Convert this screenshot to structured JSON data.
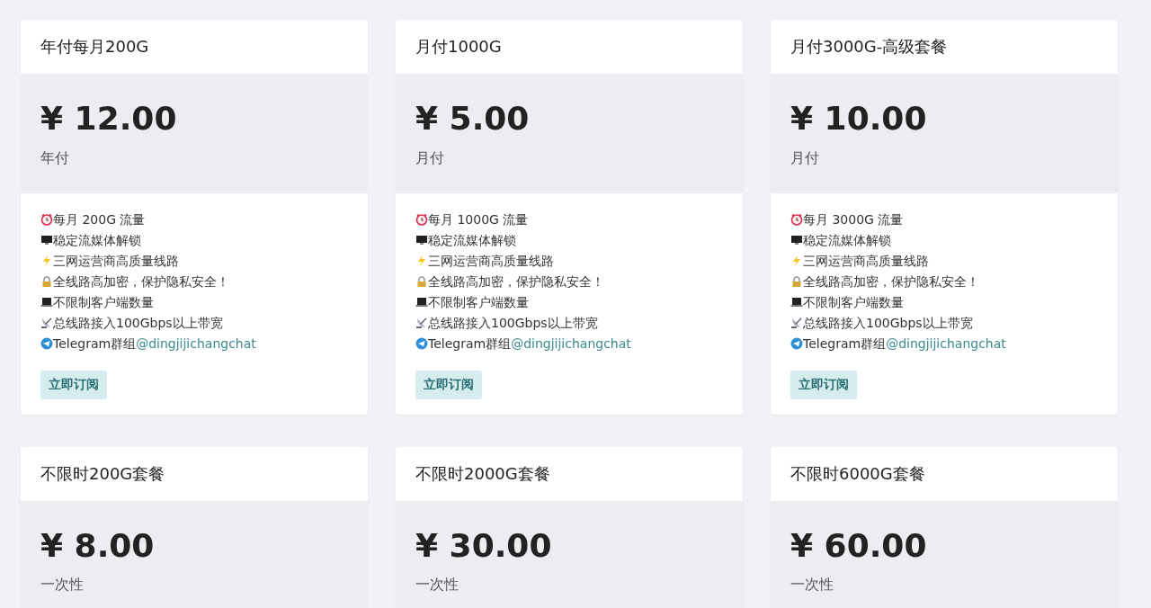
{
  "plans": [
    {
      "title": "年付每月200G",
      "price": "¥ 12.00",
      "period": "年付",
      "features": [
        {
          "kind": "clock",
          "text": "每月 200G 流量"
        },
        {
          "kind": "monitor",
          "text": "稳定流媒体解锁"
        },
        {
          "kind": "bolt",
          "text": "三网运营商高质量线路"
        },
        {
          "kind": "lock",
          "text": "全线路高加密，保护隐私安全！"
        },
        {
          "kind": "laptop",
          "text": "不限制客户端数量"
        },
        {
          "kind": "satellite",
          "text": "总线路接入100Gbps以上带宽"
        },
        {
          "kind": "telegram",
          "text": "Telegram群组",
          "link": "@dingjijichangchat"
        }
      ],
      "button": "立即订阅"
    },
    {
      "title": "月付1000G",
      "price": "¥ 5.00",
      "period": "月付",
      "features": [
        {
          "kind": "clock",
          "text": "每月 1000G 流量"
        },
        {
          "kind": "monitor",
          "text": "稳定流媒体解锁"
        },
        {
          "kind": "bolt",
          "text": "三网运营商高质量线路"
        },
        {
          "kind": "lock",
          "text": "全线路高加密，保护隐私安全！"
        },
        {
          "kind": "laptop",
          "text": "不限制客户端数量"
        },
        {
          "kind": "satellite",
          "text": "总线路接入100Gbps以上带宽"
        },
        {
          "kind": "telegram",
          "text": "Telegram群组",
          "link": "@dingjijichangchat"
        }
      ],
      "button": "立即订阅"
    },
    {
      "title": "月付3000G-高级套餐",
      "price": "¥ 10.00",
      "period": "月付",
      "features": [
        {
          "kind": "clock",
          "text": "每月 3000G 流量"
        },
        {
          "kind": "monitor",
          "text": "稳定流媒体解锁"
        },
        {
          "kind": "bolt",
          "text": "三网运营商高质量线路"
        },
        {
          "kind": "lock",
          "text": "全线路高加密，保护隐私安全！"
        },
        {
          "kind": "laptop",
          "text": "不限制客户端数量"
        },
        {
          "kind": "satellite",
          "text": "总线路接入100Gbps以上带宽"
        },
        {
          "kind": "telegram",
          "text": "Telegram群组",
          "link": "@dingjijichangchat"
        }
      ],
      "button": "立即订阅"
    },
    {
      "title": "不限时200G套餐",
      "price": "¥ 8.00",
      "period": "一次性"
    },
    {
      "title": "不限时2000G套餐",
      "price": "¥ 30.00",
      "period": "一次性"
    },
    {
      "title": "不限时6000G套餐",
      "price": "¥ 60.00",
      "period": "一次性"
    }
  ]
}
